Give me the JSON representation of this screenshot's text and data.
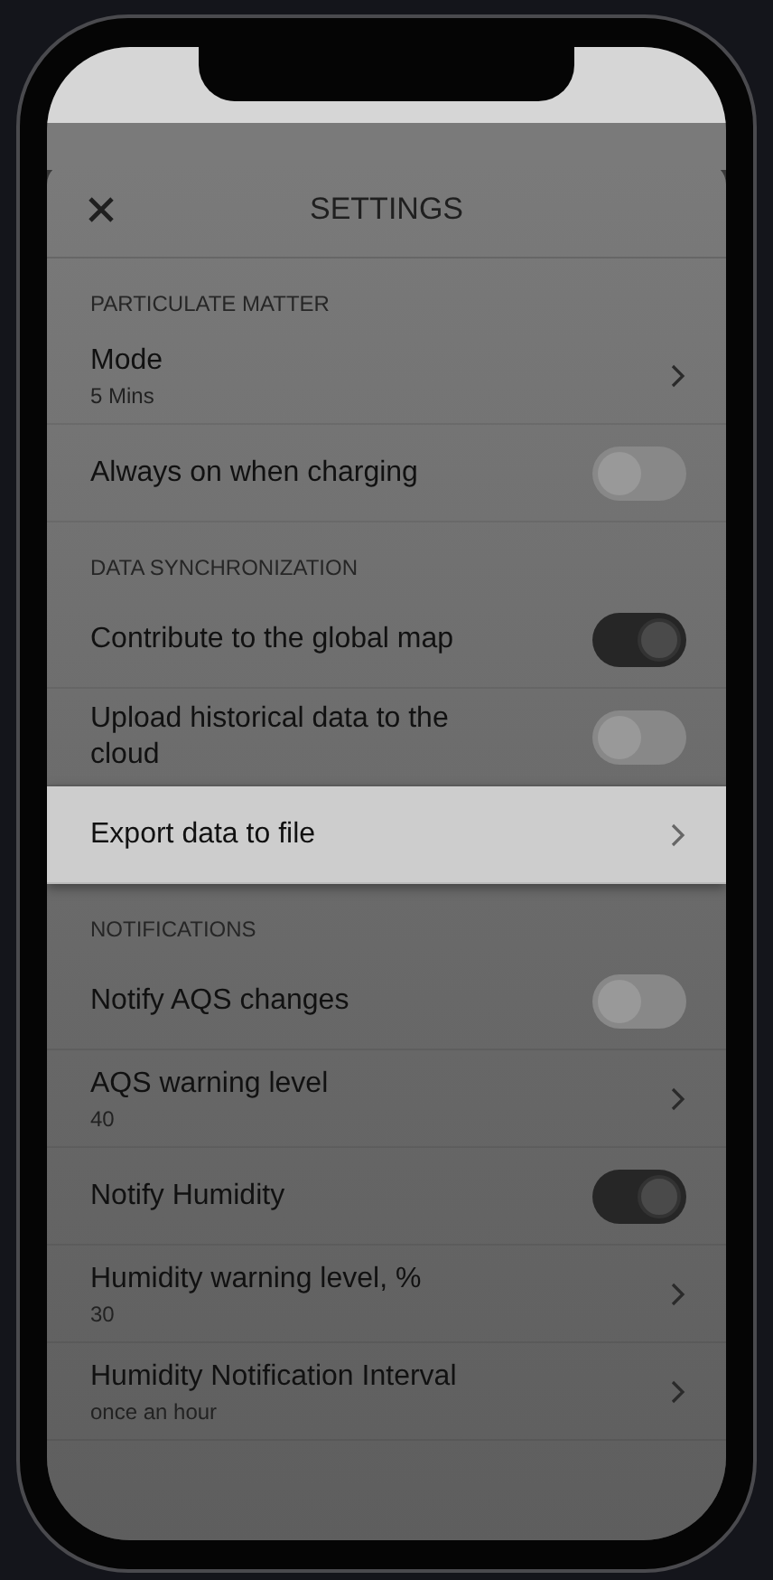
{
  "sheet": {
    "title": "SETTINGS"
  },
  "sections": [
    {
      "header": "PARTICULATE MATTER",
      "items": [
        {
          "kind": "link",
          "label": "Mode",
          "value": "5 Mins",
          "selected": false
        },
        {
          "kind": "toggle",
          "label": "Always on when charging",
          "on": false,
          "selected": false
        }
      ]
    },
    {
      "header": "DATA SYNCHRONIZATION",
      "items": [
        {
          "kind": "toggle",
          "label": "Contribute to the global map",
          "on": true,
          "selected": false
        },
        {
          "kind": "toggle",
          "label": "Upload historical data to the cloud",
          "on": false,
          "selected": false
        },
        {
          "kind": "link",
          "label": "Export data to file",
          "selected": true
        }
      ]
    },
    {
      "header": "NOTIFICATIONS",
      "items": [
        {
          "kind": "toggle",
          "label": "Notify AQS changes",
          "on": false,
          "selected": false
        },
        {
          "kind": "link",
          "label": "AQS warning level",
          "value": "40",
          "selected": false
        },
        {
          "kind": "toggle",
          "label": "Notify Humidity",
          "on": true,
          "selected": false
        },
        {
          "kind": "link",
          "label": "Humidity warning level, %",
          "value": "30",
          "selected": false
        },
        {
          "kind": "link",
          "label": "Humidity Notification Interval",
          "value": "once an hour",
          "selected": false
        }
      ]
    }
  ]
}
